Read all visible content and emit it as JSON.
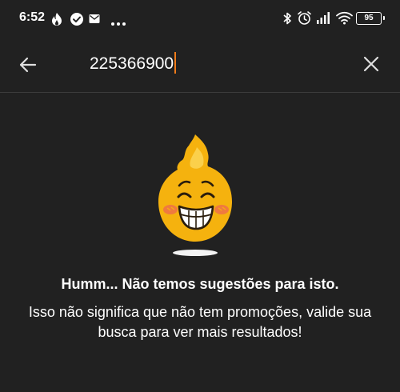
{
  "status_bar": {
    "time": "6:52",
    "left_icons": [
      "flame-notification-icon",
      "check-circle-icon",
      "mail-icon",
      "more-dots-icon"
    ],
    "right_icons": [
      "bluetooth-icon",
      "alarm-icon",
      "signal-icon",
      "wifi-icon"
    ],
    "battery": "95"
  },
  "search": {
    "query": "225366900",
    "back_icon": "arrow-left-icon",
    "clear_icon": "close-icon",
    "caret_color": "#f07b1a"
  },
  "empty_state": {
    "illustration": "smiling-flame-mascot",
    "title": "Humm... Não temos sugestões para isto.",
    "message": "Isso não significa que não tem promoções, valide sua busca para ver mais resultados!"
  },
  "colors": {
    "background": "#212121",
    "text": "#ffffff",
    "mascot_body": "#f5b20e",
    "accent": "#f07b1a"
  }
}
